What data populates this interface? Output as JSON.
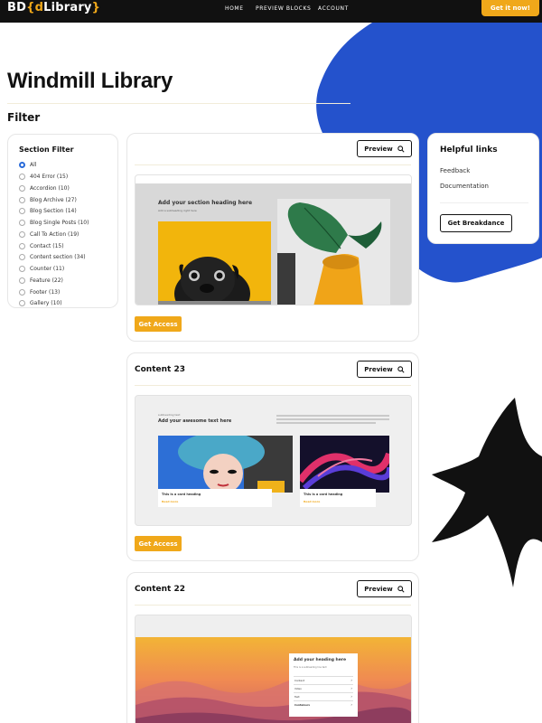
{
  "header": {
    "logo_prefix": "BD",
    "logo_brace_open": "{",
    "logo_mid": "d",
    "logo_main": "Library",
    "logo_brace_close": "}",
    "nav": [
      "HOME",
      "PREVIEW BLOCKS",
      "ACCOUNT"
    ],
    "cta": "Get it now!"
  },
  "page": {
    "title": "Windmill Library",
    "filter_heading": "Filter"
  },
  "section_filter": {
    "title": "Section Filter",
    "options": [
      "All",
      "404 Error (15)",
      "Accordion (10)",
      "Blog Archive (27)",
      "Blog Section (14)",
      "Blog Single Posts (10)",
      "Call To Action (19)",
      "Contact (15)",
      "Content section (34)",
      "Counter (11)",
      "Feature (22)",
      "Footer (13)",
      "Gallery (10)"
    ]
  },
  "blocks": [
    {
      "title": "",
      "preview_label": "Preview",
      "access_label": "Get Access",
      "thumb_heading": "Add your section heading here",
      "thumb_sub": "Add a subheading right here"
    },
    {
      "title": "Content 23",
      "preview_label": "Preview",
      "access_label": "Get Access",
      "thumb_eyebrow": "subheading text",
      "thumb_heading": "Add your awesome text here",
      "card1_title": "This is a card heading",
      "card1_link": "Read more",
      "card2_title": "This is a card heading",
      "card2_link": "Read more"
    },
    {
      "title": "Content 22",
      "preview_label": "Preview",
      "thumb_heading": "Add your heading here",
      "thumb_sub": "This is a subheading line text",
      "list": [
        "Content",
        "Video",
        "Text",
        "Containers"
      ]
    }
  ],
  "helpful": {
    "title": "Helpful links",
    "links": [
      "Feedback",
      "Documentation"
    ],
    "button": "Get Breakdance"
  },
  "colors": {
    "accent": "#f0a81a",
    "blob_blue": "#2452cc",
    "dark": "#111111"
  },
  "icons": {
    "preview": "search-icon",
    "chevron": "chevron-right-icon"
  }
}
